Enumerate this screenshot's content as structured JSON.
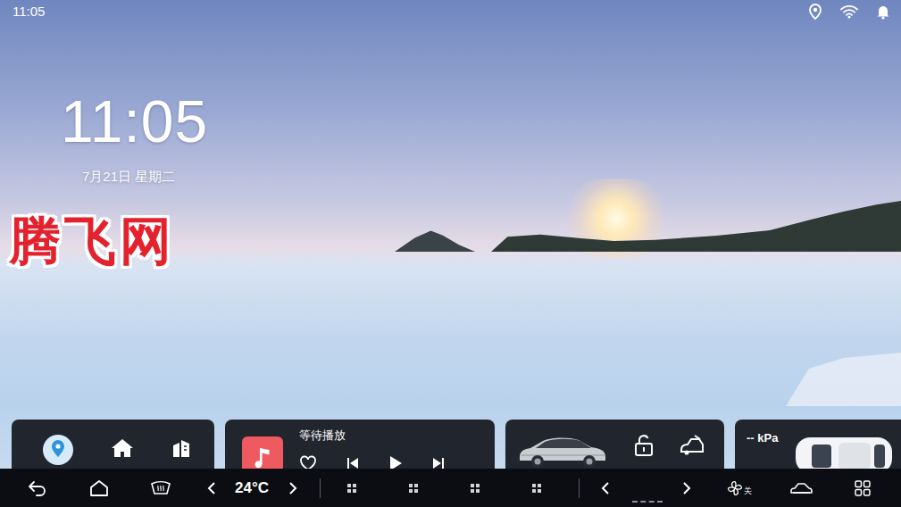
{
  "status_bar": {
    "time": "11:05"
  },
  "clock": {
    "time": "11:05",
    "date": "7月21日 星期二"
  },
  "watermark": "腾飞网",
  "media_card": {
    "title": "等待播放"
  },
  "tire_card": {
    "pressure": "-- kPa"
  },
  "dock": {
    "temperature": "24°C",
    "fan_state": "关"
  }
}
